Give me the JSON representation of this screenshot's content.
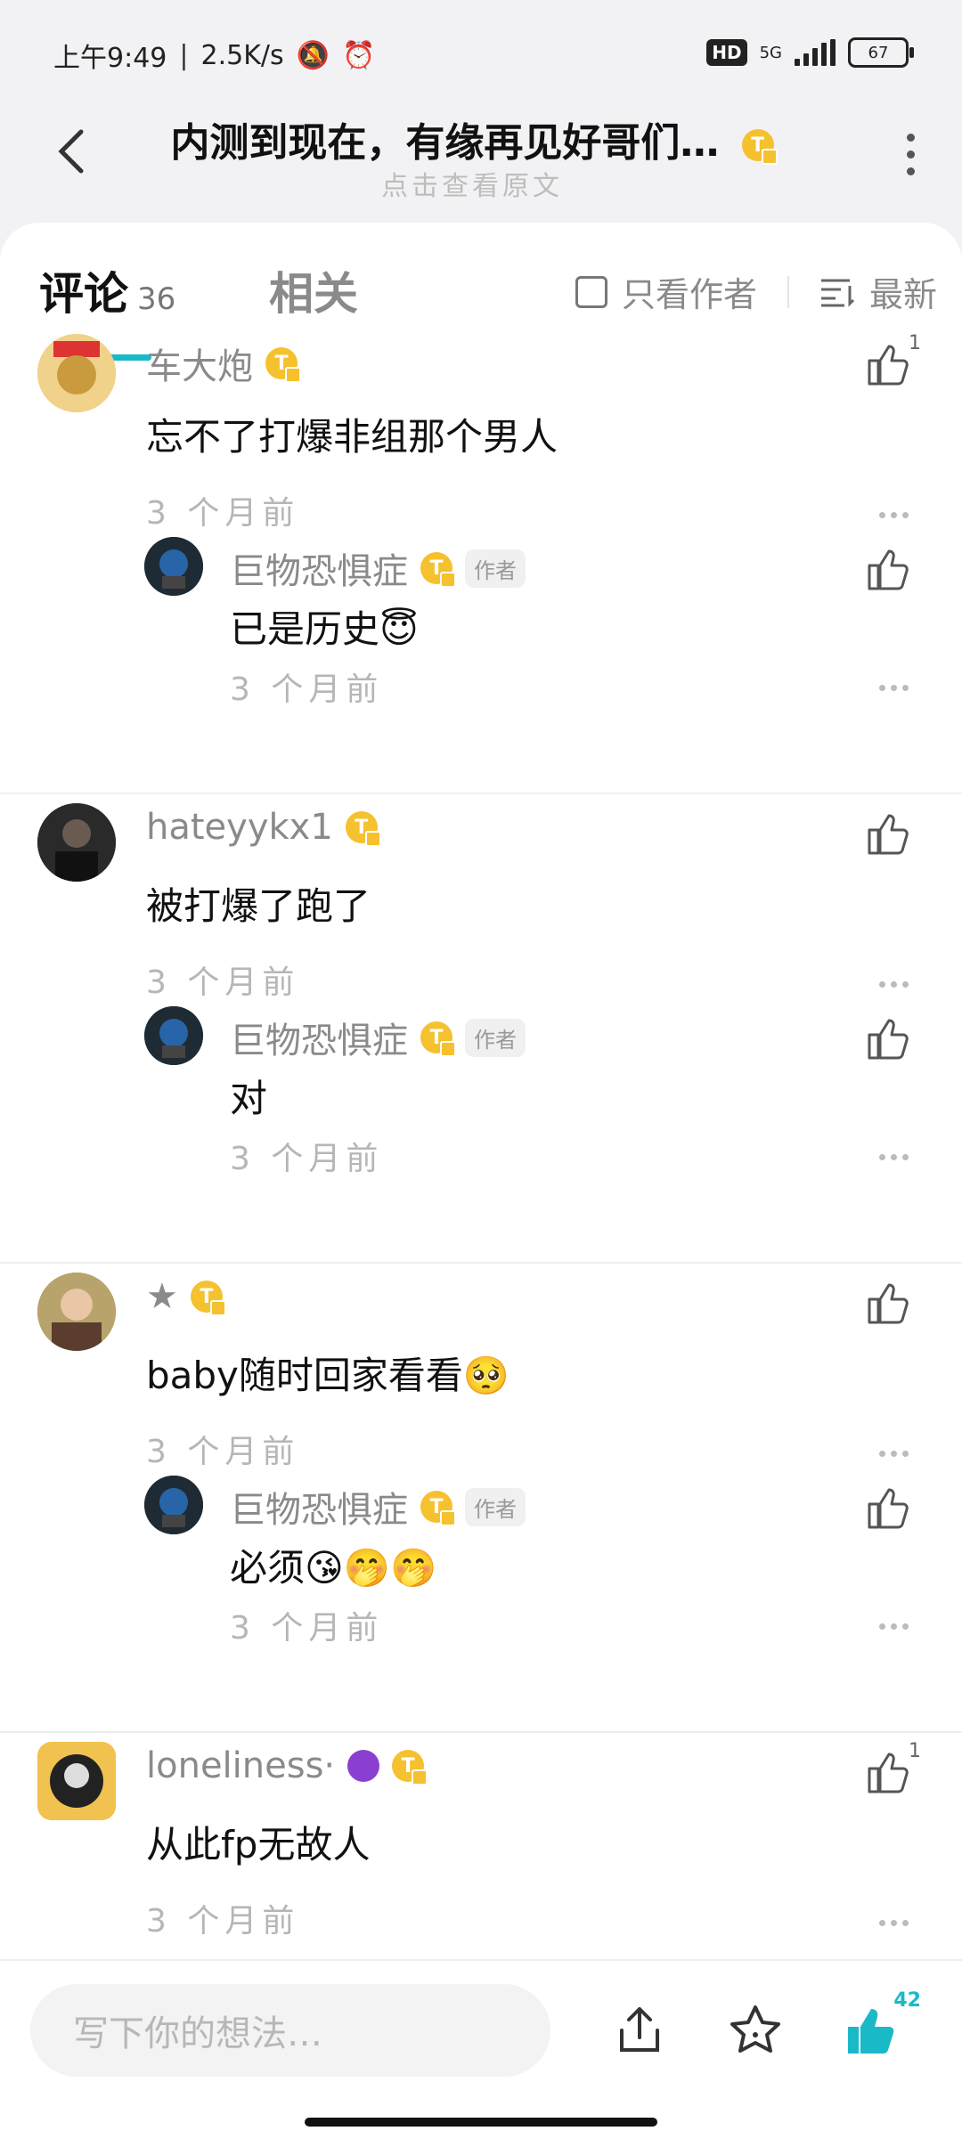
{
  "status_bar": {
    "time": "上午9:49",
    "speed": "2.5K/s",
    "hd": "HD",
    "network": "5G",
    "battery": "67"
  },
  "header": {
    "title": "内测到现在，有缘再见好哥们…",
    "subtitle": "点击查看原文"
  },
  "tabs": {
    "comments_label": "评论",
    "comments_count": "36",
    "related_label": "相关",
    "author_only": "只看作者",
    "sort": "最新"
  },
  "comments": [
    {
      "user": "车大炮",
      "text": "忘不了打爆非组那个男人",
      "time": "3 个月前",
      "likes": "1",
      "reply": {
        "user": "巨物恐惧症",
        "tag": "作者",
        "text": "已是历史😇",
        "time": "3 个月前"
      }
    },
    {
      "user": "hateyykx1",
      "text": "被打爆了跑了",
      "time": "3 个月前",
      "likes": "",
      "reply": {
        "user": "巨物恐惧症",
        "tag": "作者",
        "text": "对",
        "time": "3 个月前"
      }
    },
    {
      "user": "★",
      "text": "baby随时回家看看🥺",
      "time": "3 个月前",
      "likes": "",
      "reply": {
        "user": "巨物恐惧症",
        "tag": "作者",
        "text": "必须😘🤭🤭",
        "time": "3 个月前"
      }
    },
    {
      "user": "loneliness·",
      "text": "从此fp无故人",
      "time": "3 个月前",
      "likes": "1"
    }
  ],
  "bottom_bar": {
    "placeholder": "写下你的想法…",
    "like_count": "42"
  },
  "colors": {
    "accent": "#19b9c8",
    "badge": "#f5c12e"
  }
}
